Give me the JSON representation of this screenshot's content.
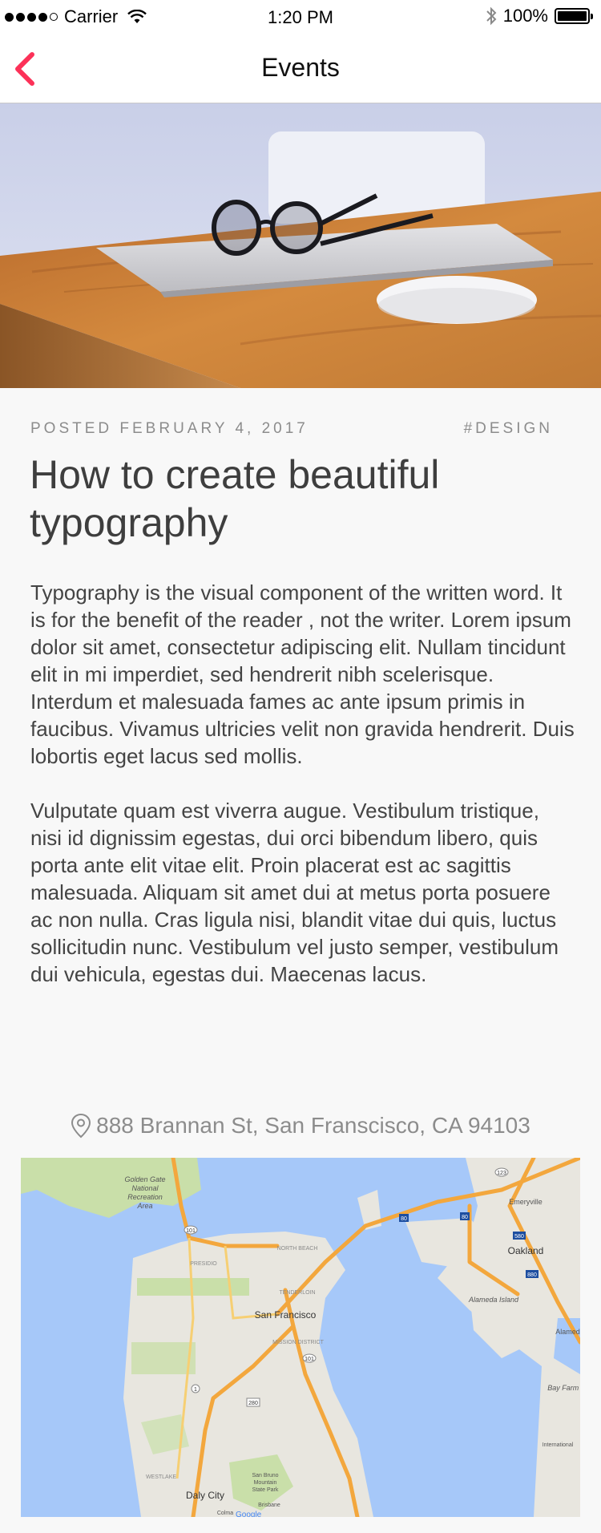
{
  "status_bar": {
    "carrier": "Carrier",
    "time": "1:20 PM",
    "battery": "100%"
  },
  "nav": {
    "title": "Events"
  },
  "article": {
    "posted": "POSTED FEBRUARY 4, 2017",
    "tag": "#DESIGN",
    "title": "How to create beautiful typography",
    "paragraphs": [
      "Typography is the visual component of the written word. It is for the benefit of the reader , not the writer. Lorem ipsum dolor sit amet, consectetur adipiscing elit. Nullam tincidunt elit in mi imperdiet, sed hendrerit nibh scelerisque. Interdum et malesuada fames ac ante ipsum primis in faucibus. Vivamus ultricies velit non gravida hendrerit. Duis lobortis eget lacus sed mollis.",
      "Vulputate quam est viverra augue. Vestibulum tristique, nisi id dignissim egestas, dui orci bibendum libero, quis porta ante elit vitae elit. Proin placerat est ac sagittis malesuada. Aliquam sit amet dui at metus porta posuere ac non nulla. Cras ligula nisi, blandit vitae dui quis, luctus sollicitudin nunc. Vestibulum vel justo semper, vestibulum dui vehicula, egestas dui. Maecenas lacus."
    ]
  },
  "location": {
    "address": "888 Brannan St, San Franscisco, CA 94103"
  },
  "map": {
    "labels": {
      "golden_gate": "Golden Gate National Recreation Area",
      "presidio": "PRESIDIO",
      "north_beach": "NORTH BEACH",
      "tenderloin": "TENDERLOIN",
      "san_francisco": "San Francisco",
      "mission": "MISSION DISTRICT",
      "westlake": "WESTLAKE",
      "daly_city": "Daly City",
      "colma": "Colma",
      "san_bruno": "San Bruno Mountain State Park",
      "brisbane": "Brisbane",
      "emeryville": "Emeryville",
      "oakland": "Oakland",
      "alameda_island": "Alameda Island",
      "alameda": "Alameda",
      "bay_farm": "Bay Farm Isla",
      "international": "International",
      "google": "Google",
      "hwy_101a": "101",
      "hwy_101b": "101",
      "hwy_1": "1",
      "hwy_280": "280",
      "hwy_80a": "80",
      "hwy_80b": "80",
      "hwy_580": "580",
      "hwy_880": "880",
      "hwy_123": "123"
    },
    "colors": {
      "water": "#a6c8f9",
      "land": "#e8e6df",
      "park": "#c9dfa9",
      "highway": "#f3a73d"
    }
  },
  "colors": {
    "accent": "#fc3158",
    "background": "#f8f8f8"
  }
}
